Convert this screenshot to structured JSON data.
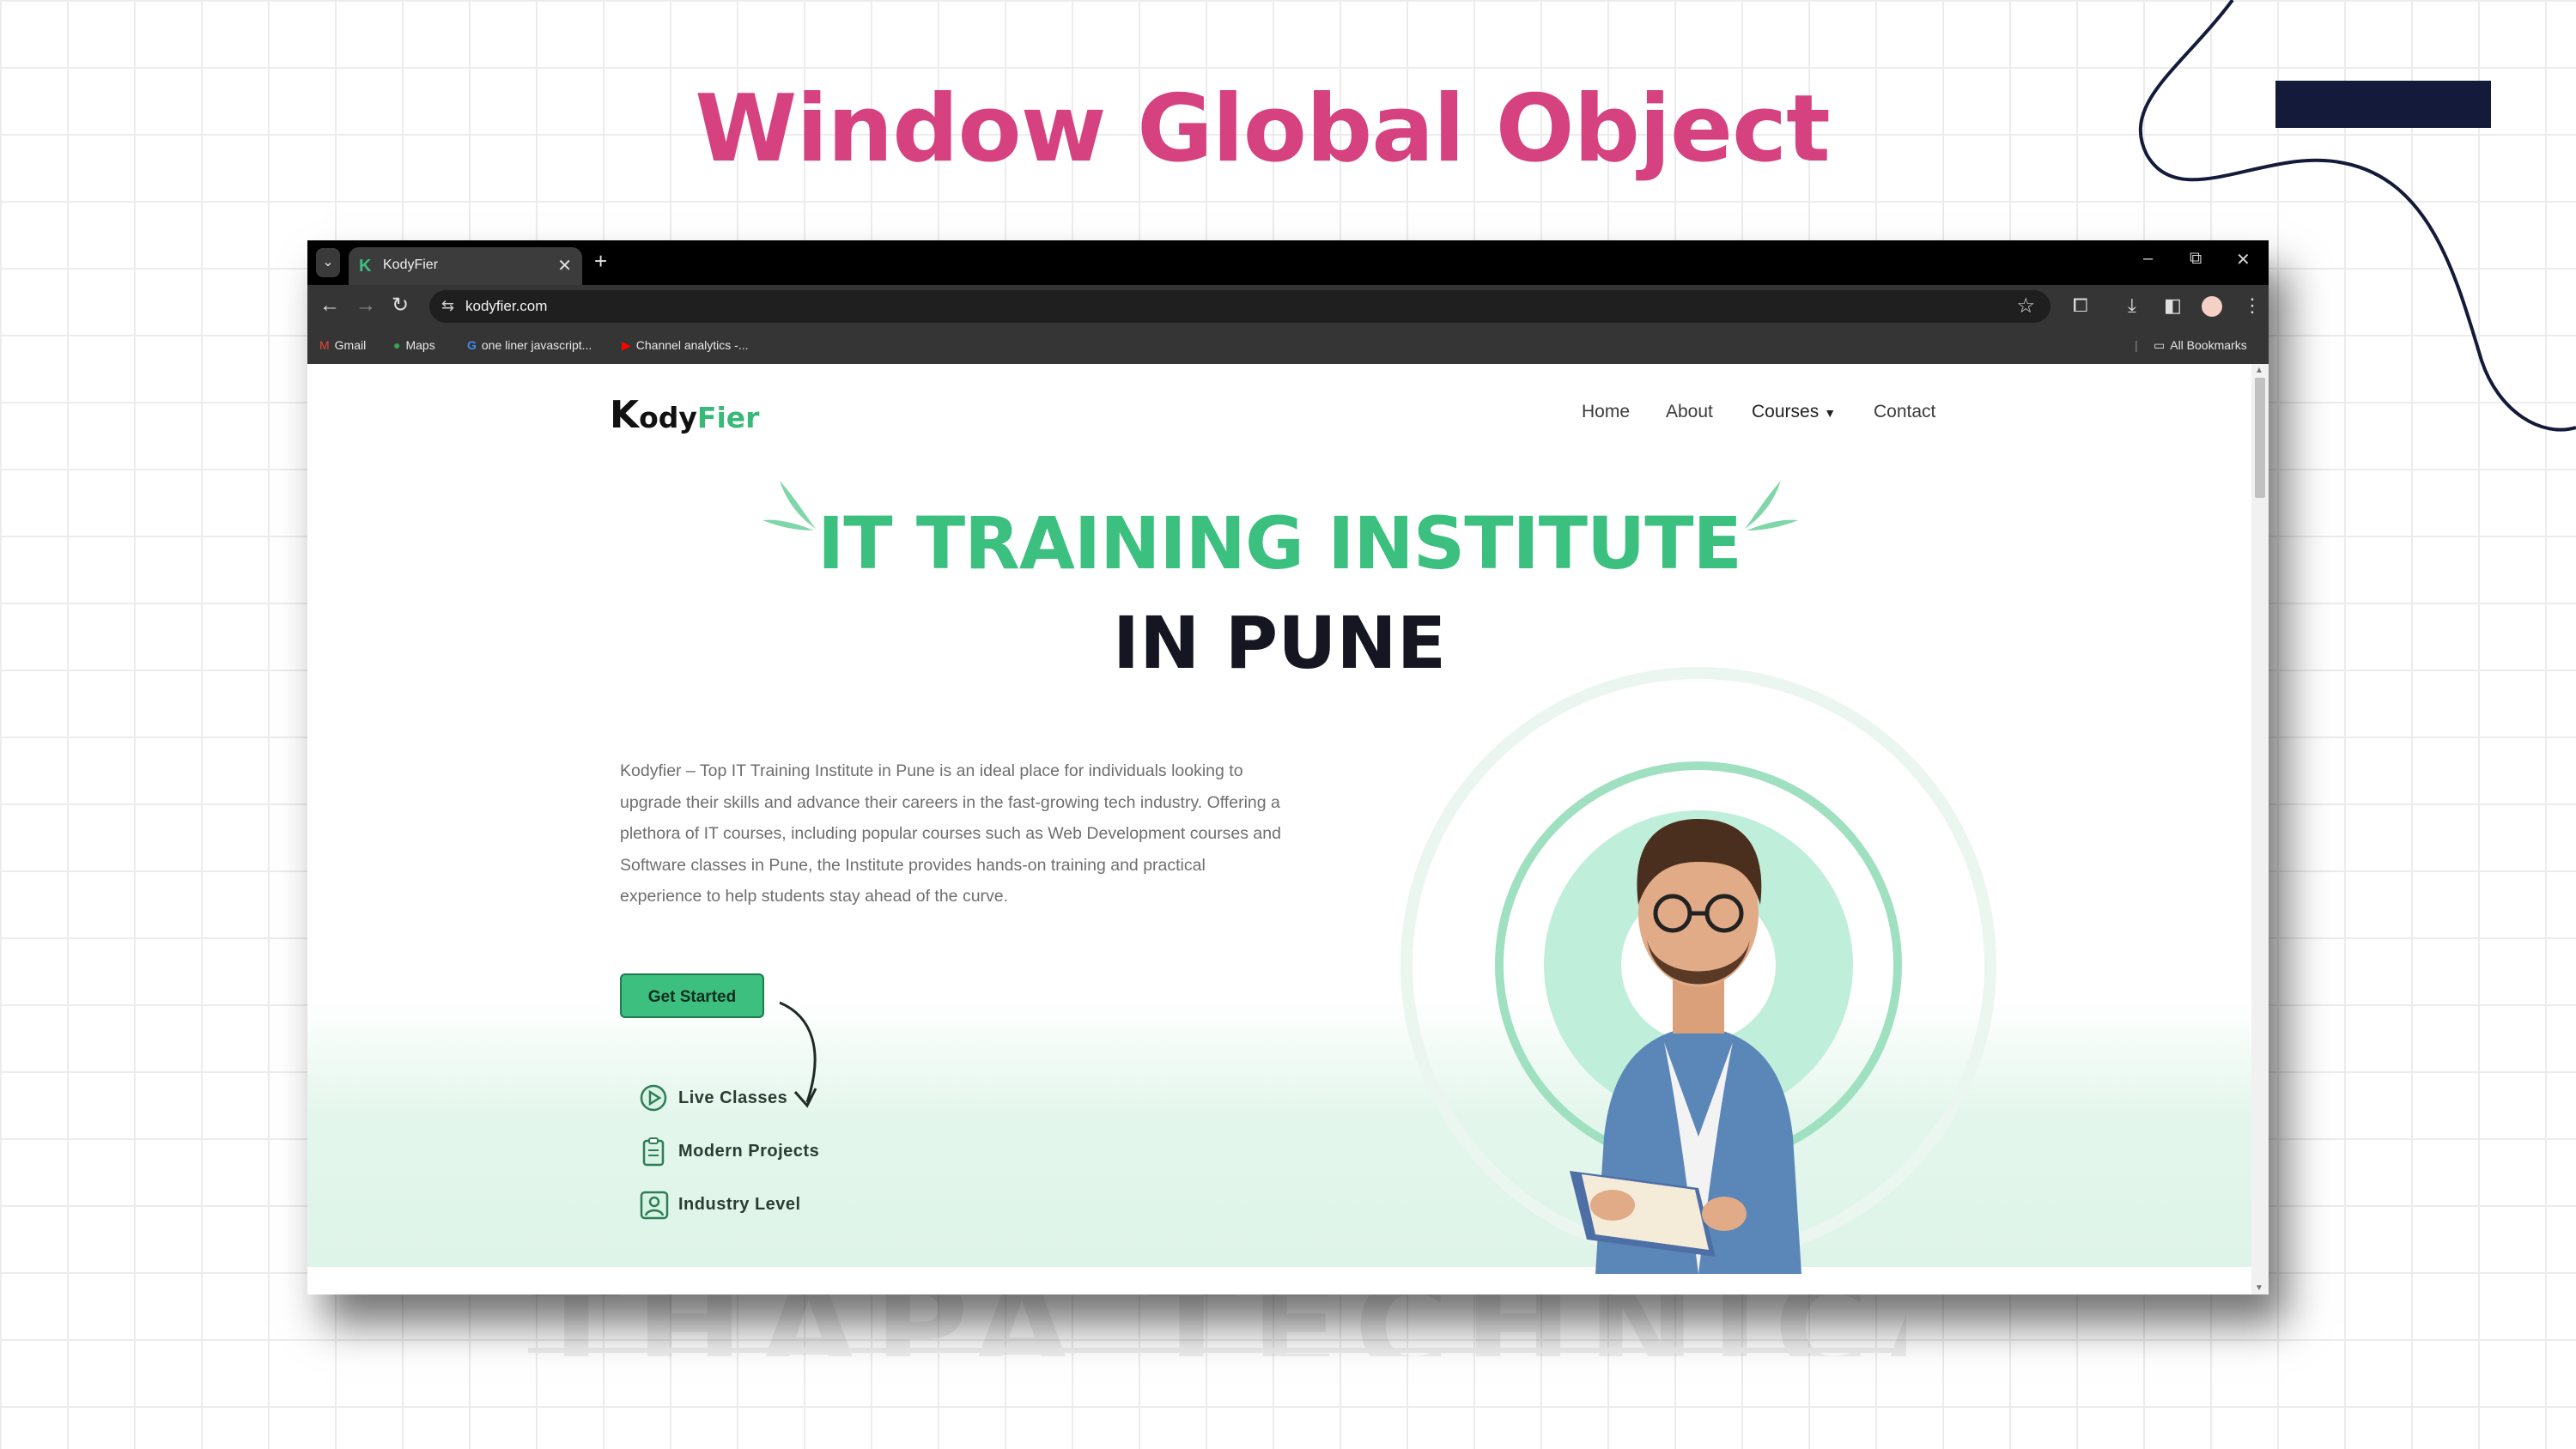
{
  "slide": {
    "title": "Window Global Object"
  },
  "browser": {
    "tab": {
      "title": "KodyFier",
      "favicon": "K"
    },
    "address": {
      "url": "kodyfier.com"
    },
    "bookmarks": [
      {
        "label": "Gmail",
        "icon": "gmail-icon"
      },
      {
        "label": "Maps",
        "icon": "maps-icon"
      },
      {
        "label": "one liner javascript...",
        "icon": "google-icon"
      },
      {
        "label": "Channel analytics -...",
        "icon": "youtube-icon"
      }
    ],
    "all_bookmarks_label": "All Bookmarks"
  },
  "site": {
    "logo": {
      "k": "K",
      "ody": "ody",
      "fier": "Fier"
    },
    "nav": {
      "home": "Home",
      "about": "About",
      "courses": "Courses",
      "contact": "Contact"
    },
    "hero": {
      "title_line1": "IT TRAINING INSTITUTE",
      "title_line2": "IN PUNE",
      "description": "Kodyfier – Top IT Training Institute in Pune is an ideal place for individuals looking to upgrade their skills and advance their careers in the fast-growing tech industry. Offering a plethora of IT courses, including popular courses such as Web Development courses and Software classes in Pune, the Institute provides hands-on training and practical experience to help students stay ahead of the curve.",
      "cta_label": "Get Started",
      "features": [
        {
          "label": "Live Classes",
          "icon": "play-circle-icon"
        },
        {
          "label": "Modern Projects",
          "icon": "clipboard-icon"
        },
        {
          "label": "Industry Level",
          "icon": "user-badge-icon"
        }
      ]
    }
  },
  "colors": {
    "slide_title": "#d6417f",
    "brand_green": "#3cc07f",
    "navy_accent": "#141b3a"
  }
}
